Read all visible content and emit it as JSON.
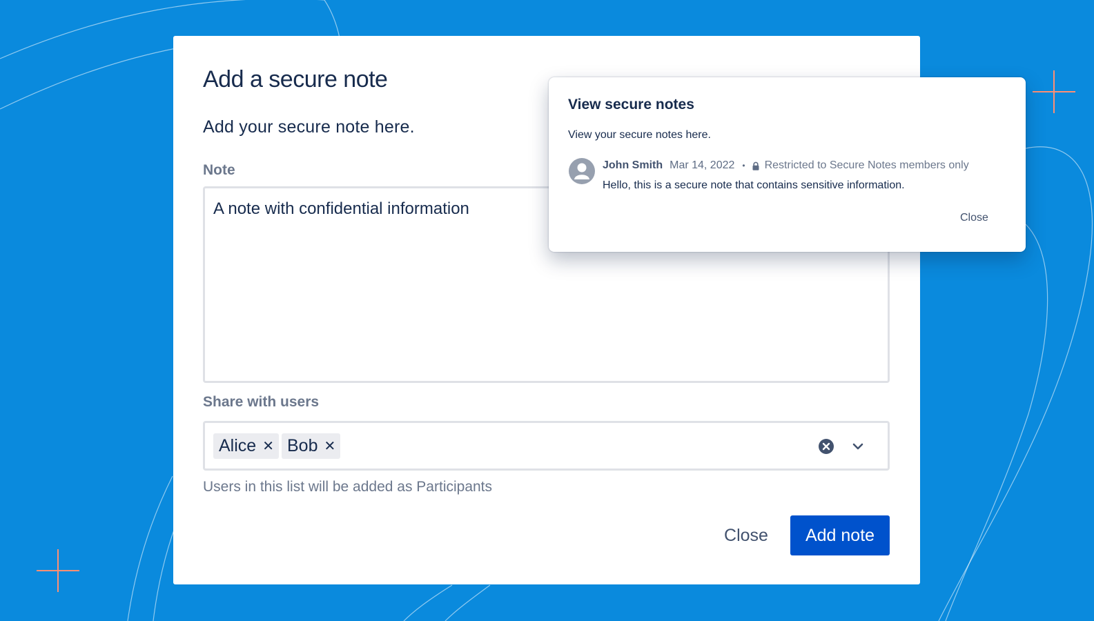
{
  "background": {
    "color": "#0a8add",
    "accent": "#ff8f73"
  },
  "add_note_dialog": {
    "title": "Add a secure note",
    "description": "Add your secure note here.",
    "note_label": "Note",
    "note_value": "A note with confidential information",
    "share_label": "Share with users",
    "selected_users": [
      {
        "name": "Alice",
        "remove_icon": "close-icon"
      },
      {
        "name": "Bob",
        "remove_icon": "close-icon"
      }
    ],
    "clear_icon": "clear-circle-icon",
    "dropdown_icon": "chevron-down-icon",
    "helper_text": "Users in this list will be added as Participants",
    "close_label": "Close",
    "submit_label": "Add note",
    "primary_color": "#0052cc"
  },
  "view_notes_popup": {
    "title": "View secure notes",
    "description": "View your secure notes here.",
    "note": {
      "avatar_icon": "user-avatar-icon",
      "author": "John Smith",
      "date": "Mar 14, 2022",
      "separator": "•",
      "lock_icon": "lock-icon",
      "restriction": "Restricted to Secure Notes members only",
      "body": "Hello, this is a secure note that contains sensitive information."
    },
    "close_label": "Close"
  }
}
